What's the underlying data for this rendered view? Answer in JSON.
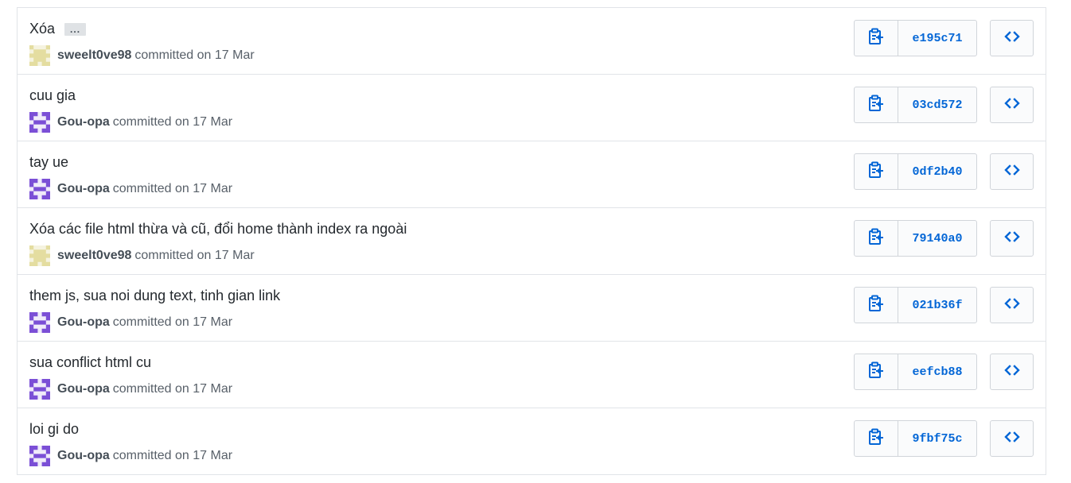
{
  "commits": [
    {
      "message": "Xóa",
      "ellipsis": "...",
      "author": "sweelt0ve98",
      "committed_text": "committed on 17 Mar",
      "sha": "e195c71",
      "avatar": "sweelt-avatar"
    },
    {
      "message": "cuu gia",
      "author": "Gou-opa",
      "committed_text": "committed on 17 Mar",
      "sha": "03cd572",
      "avatar": "gou-avatar"
    },
    {
      "message": "tay ue",
      "author": "Gou-opa",
      "committed_text": "committed on 17 Mar",
      "sha": "0df2b40",
      "avatar": "gou-avatar"
    },
    {
      "message": "Xóa các file html thừa và cũ, đổi home thành index ra ngoài",
      "author": "sweelt0ve98",
      "committed_text": "committed on 17 Mar",
      "sha": "79140a0",
      "avatar": "sweelt-avatar"
    },
    {
      "message": "them js, sua noi dung text, tinh gian link",
      "author": "Gou-opa",
      "committed_text": "committed on 17 Mar",
      "sha": "021b36f",
      "avatar": "gou-avatar"
    },
    {
      "message": "sua conflict html cu",
      "author": "Gou-opa",
      "committed_text": "committed on 17 Mar",
      "sha": "eefcb88",
      "avatar": "gou-avatar"
    },
    {
      "message": "loi gi do",
      "author": "Gou-opa",
      "committed_text": "committed on 17 Mar",
      "sha": "9fbf75c",
      "avatar": "gou-avatar"
    }
  ],
  "icons": {
    "copy": "clipboard-copy-icon",
    "browse": "code-icon"
  },
  "colors": {
    "link": "#0366d6",
    "text": "#24292e",
    "muted": "#586069",
    "border": "#e1e4e8",
    "sweelt_avatar": "#e8e2b0",
    "gou_avatar": "#7b4fd6"
  }
}
